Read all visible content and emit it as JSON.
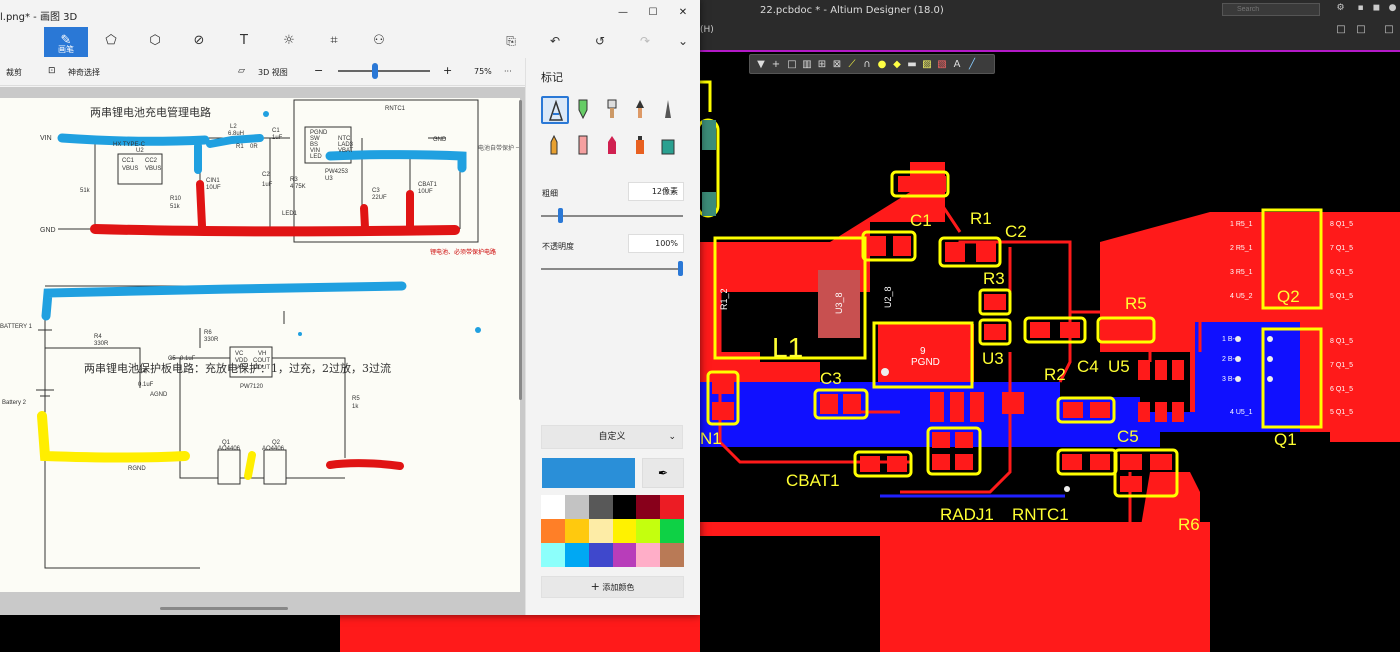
{
  "altium": {
    "title": "22.pcbdoc * - Altium Designer (18.0)",
    "search_placeholder": "Search",
    "menu_fragment": "(H)",
    "accent": "#b419c8",
    "toolbar_icons": [
      "filter-icon",
      "route-icon",
      "select-rect-icon",
      "chart-icon",
      "bus-icon",
      "wire-icon",
      "measure-icon",
      "pad-icon",
      "highlight-icon",
      "fill-icon",
      "polygon-icon",
      "region-icon",
      "text-icon",
      "line-icon"
    ],
    "designators": [
      "C1",
      "R1",
      "C2",
      "R3",
      "L1",
      "U3",
      "R5",
      "C3",
      "R2",
      "C4",
      "U5",
      "Q2",
      "Q1",
      "C5",
      "CBAT1",
      "RADJ1",
      "RNTC1",
      "R6",
      "N1",
      "R1_2",
      "U3_8",
      "U2_8",
      "9",
      "PGND"
    ],
    "q_pins_left": [
      "1  R5_1",
      "2  R5_1",
      "3  R5_1",
      "4  U5_2",
      "1  B-",
      "2  B-",
      "3  B-",
      "4  U5_1"
    ],
    "q_pins_right": [
      "8  Q1_5",
      "7  Q1_5",
      "6  Q1_5",
      "5  Q1_5",
      "8  Q1_5",
      "7  Q1_5",
      "6  Q1_5",
      "5  Q1_5"
    ]
  },
  "paint": {
    "title": "l.png* - 画图 3D",
    "tools": [
      {
        "name": "brush",
        "label": "画笔"
      },
      {
        "name": "2d-shapes"
      },
      {
        "name": "3d-shapes"
      },
      {
        "name": "stickers"
      },
      {
        "name": "text"
      },
      {
        "name": "effects"
      },
      {
        "name": "canvas"
      },
      {
        "name": "3d-library"
      }
    ],
    "subbar": {
      "crop": "裁剪",
      "magic_select": "神奇选择",
      "view_3d": "3D 视图",
      "zoom_minus": "−",
      "zoom_plus": "+",
      "zoom_level": "75%",
      "more": "···"
    },
    "zoom_fraction": 0.4,
    "side": {
      "title": "标记",
      "thickness_label": "粗细",
      "thickness_value": "12像素",
      "thickness_fraction": 0.12,
      "opacity_label": "不透明度",
      "opacity_value": "100%",
      "opacity_fraction": 1.0,
      "color_mode": "自定义",
      "selected_color": "#2a8fd8",
      "add_color": "添加颜色",
      "palette": [
        "#ffffff",
        "#c3c3c3",
        "#585858",
        "#000000",
        "#88001b",
        "#ec1c24",
        "#ff7f27",
        "#ffc90e",
        "#fdeca6",
        "#fff200",
        "#c4ff0e",
        "#0ed145",
        "#8cfffb",
        "#00a8f3",
        "#3f48cc",
        "#b83dba",
        "#ffaec8",
        "#b97a56"
      ]
    },
    "document": {
      "title1": "两串锂电池充电管理电路",
      "title2": "两串锂电池保护板电路：充放电保护：1，过充，2过放，3过流",
      "vin": "VIN",
      "gnd": "GND",
      "note_red": "锂电池、必须带保护电路",
      "note_side": "电池自带保护\n一般是两线的",
      "battery1": "BATTERY 1",
      "battery2": "Battery 2",
      "rgnd": "RGND",
      "agnd": "AGND",
      "parts": [
        "L2",
        "6.8uH",
        "R1",
        "0R",
        "C1",
        "1uF",
        "RNTC1",
        "PGND",
        "SW",
        "BS",
        "VIN",
        "LED",
        "NTC",
        "LAD3",
        "VBAT",
        "PW4253",
        "U3",
        "C2",
        "1uF",
        "R3",
        "4.75K",
        "LED1",
        "C3",
        "22UF",
        "CBAT1",
        "10UF",
        "CIN1",
        "10UF",
        "R10",
        "51k",
        "51k",
        "HX TYPE-C",
        "U2",
        "CC1",
        "CC2",
        "VBUS",
        "VBUS",
        "R4",
        "330R",
        "R6",
        "330R",
        "C4",
        "0.1uF",
        "C5",
        "0.1uF",
        "VC",
        "VDD",
        "VSS",
        "VH",
        "COUT",
        "DOUT",
        "PW7120",
        "Q1",
        "Q2",
        "AO4406",
        "AO4406",
        "R5",
        "1k",
        "GND"
      ]
    }
  }
}
